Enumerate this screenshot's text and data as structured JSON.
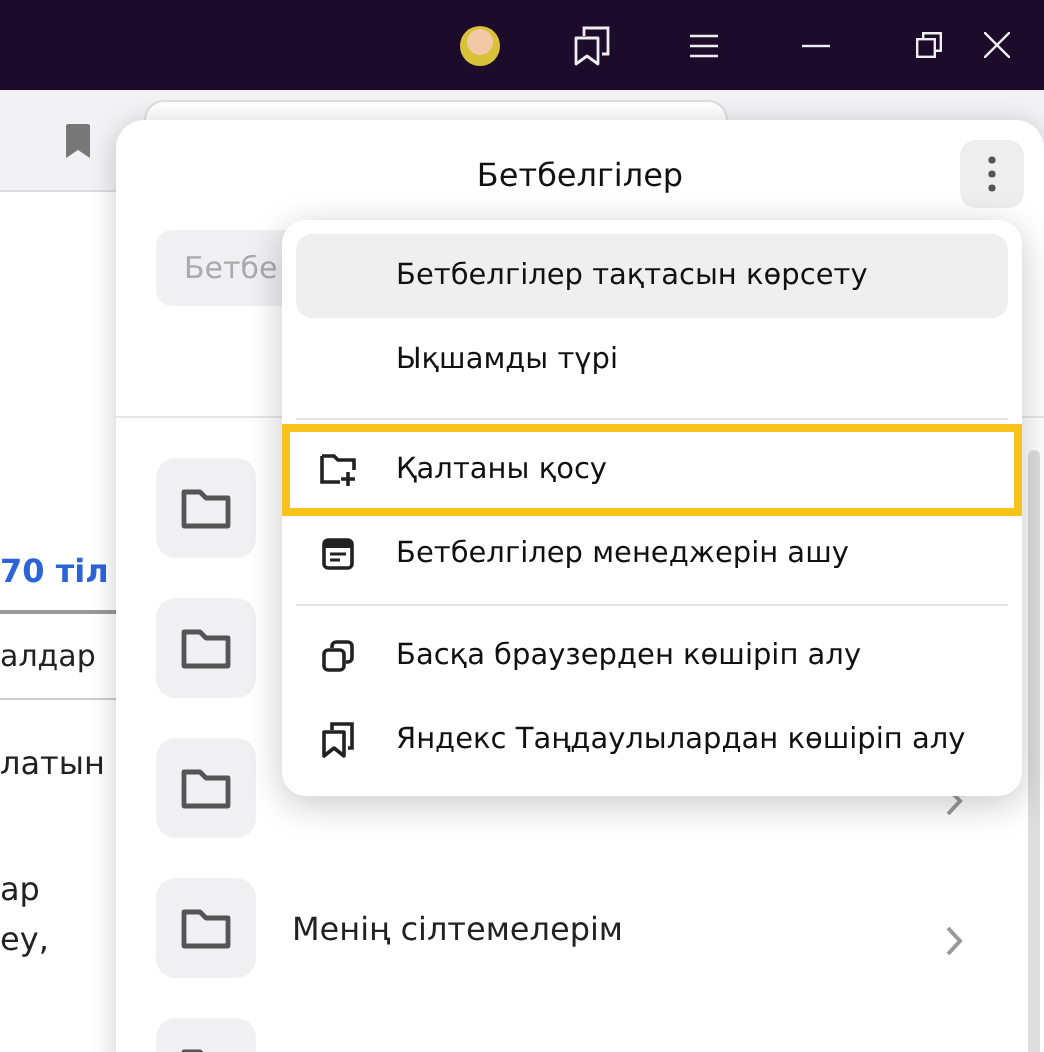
{
  "background_page": {
    "texts": [
      {
        "text": "70 тіл",
        "kind": "link"
      },
      {
        "text": "алдар",
        "kind": "select"
      },
      {
        "text": "латын",
        "kind": "plain"
      },
      {
        "text": "ар",
        "kind": "plain"
      },
      {
        "text": "еу,",
        "kind": "plain"
      }
    ]
  },
  "bookmarks_panel": {
    "title": "Бетбелгілер",
    "search": {
      "placeholder": "Бетбе"
    },
    "folders": [
      {
        "kind": "folder",
        "chevron": false
      },
      {
        "kind": "folder",
        "chevron": false
      },
      {
        "kind": "folder",
        "chevron": true
      },
      {
        "kind": "folder",
        "label": "Менің сілтемелерім",
        "chevron": true
      },
      {
        "kind": "folder",
        "chevron": false
      }
    ]
  },
  "menu": {
    "groups": [
      [
        {
          "label": "Бетбелгілер тақтасын көрсету",
          "kind": "plain",
          "selected": true,
          "outlined": false
        },
        {
          "label": "Ықшамды түрі",
          "kind": "plain",
          "selected": false,
          "outlined": false
        }
      ],
      [
        {
          "label": "Қалтаны қосу",
          "kind": "folder",
          "selected": false,
          "outlined": true
        },
        {
          "label": "Бетбелгілер менеджерін ашу",
          "kind": "manager",
          "selected": false,
          "outlined": false
        }
      ],
      [
        {
          "label": "Басқа браузерден көшіріп алу",
          "kind": "browser",
          "selected": false,
          "outlined": false
        },
        {
          "label": "Яндекс Таңдаулылардан көшіріп алу",
          "kind": "collection",
          "selected": false,
          "outlined": false
        }
      ]
    ]
  }
}
